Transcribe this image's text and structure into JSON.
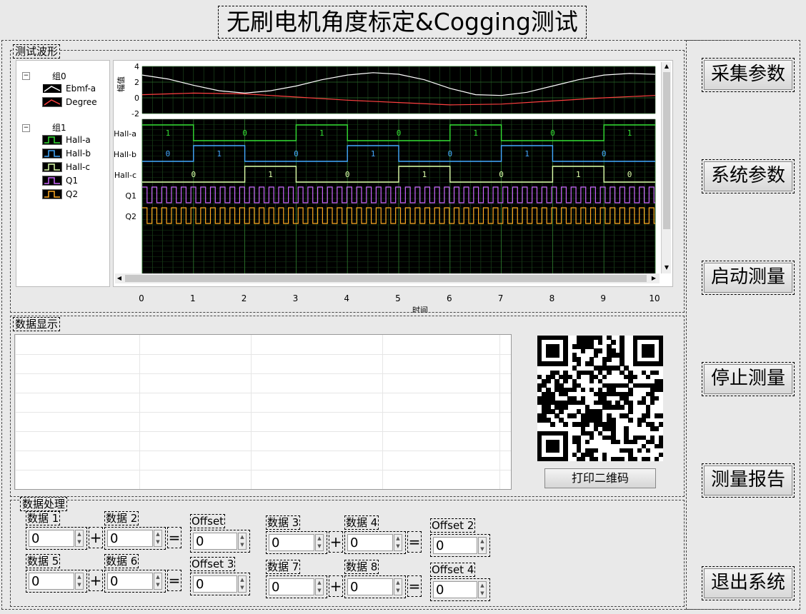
{
  "title": "无刷电机角度标定&Cogging测试",
  "waveform_section": {
    "label": "测试波形",
    "groups": [
      {
        "name": "组0",
        "items": [
          {
            "name": "Ebmf-a",
            "color": "#ffffff"
          },
          {
            "name": "Degree",
            "color": "#ff4040"
          }
        ]
      },
      {
        "name": "组1",
        "items": [
          {
            "name": "Hall-a",
            "color": "#33dd33"
          },
          {
            "name": "Hall-b",
            "color": "#44aaff"
          },
          {
            "name": "Hall-c",
            "color": "#ddffaa"
          },
          {
            "name": "Q1",
            "color": "#cc66ff"
          },
          {
            "name": "Q2",
            "color": "#ffaa22"
          }
        ]
      }
    ],
    "top_axis_label": "幅值",
    "x_axis_label": "时间"
  },
  "chart_data": {
    "type": "line",
    "title": "",
    "xlabel": "时间",
    "ylabel": "幅值",
    "x_ticks": [
      0,
      1,
      2,
      3,
      4,
      5,
      6,
      7,
      8,
      9,
      10
    ],
    "xlim": [
      0,
      10
    ],
    "analog_ylim": [
      -2,
      4
    ],
    "analog_yticks": [
      4,
      2,
      0,
      -2
    ],
    "analog_series": [
      {
        "name": "Ebmf-a",
        "color": "#ffffff",
        "x": [
          0,
          0.5,
          1,
          1.5,
          2,
          2.5,
          3,
          3.5,
          4,
          4.5,
          5,
          5.5,
          6,
          6.5,
          7,
          7.5,
          8,
          8.5,
          9,
          9.5,
          10
        ],
        "y": [
          2.9,
          2.4,
          1.6,
          0.9,
          0.6,
          0.9,
          1.5,
          2.3,
          2.9,
          3.2,
          3.0,
          2.3,
          1.2,
          0.4,
          0.3,
          0.7,
          1.5,
          2.3,
          2.9,
          3.1,
          3.0
        ]
      },
      {
        "name": "Degree",
        "color": "#ff4040",
        "x": [
          0,
          1,
          2,
          3,
          4,
          5,
          6,
          7,
          8,
          9,
          10
        ],
        "y": [
          0.4,
          0.6,
          0.5,
          0.1,
          -0.3,
          -0.6,
          -0.9,
          -0.8,
          -0.4,
          0.0,
          0.3
        ]
      }
    ],
    "digital_series": [
      {
        "name": "Hall-a",
        "color": "#33dd33",
        "transitions": [
          0,
          1,
          3,
          4,
          6,
          7,
          9,
          10
        ],
        "levels": [
          1,
          0,
          1,
          0,
          1,
          0,
          1
        ],
        "labels": [
          "1",
          "0",
          "1",
          "0",
          "1",
          "0",
          "1"
        ]
      },
      {
        "name": "Hall-b",
        "color": "#44aaff",
        "transitions": [
          0,
          1,
          2,
          4,
          5,
          7,
          8,
          10
        ],
        "levels": [
          0,
          1,
          0,
          1,
          0,
          1,
          0
        ],
        "labels": [
          "0",
          "1",
          "0",
          "1",
          "0",
          "1",
          "0"
        ]
      },
      {
        "name": "Hall-c",
        "color": "#ddffaa",
        "transitions": [
          0,
          2,
          3,
          5,
          6,
          8,
          9,
          10
        ],
        "levels": [
          0,
          1,
          0,
          1,
          0,
          1,
          0
        ],
        "labels": [
          "0",
          "1",
          "0",
          "1",
          "0",
          "1",
          "0"
        ]
      },
      {
        "name": "Q1",
        "color": "#cc66ff",
        "period": 0.19,
        "labels": []
      },
      {
        "name": "Q2",
        "color": "#ffaa22",
        "period": 0.19,
        "labels": []
      }
    ],
    "grid": true,
    "background": "#000000"
  },
  "data_display": {
    "label": "数据显示",
    "print_qr_button": "打印二维码"
  },
  "data_processing": {
    "label": "数据处理",
    "rows": [
      {
        "a_label": "数据 1",
        "a_val": "0",
        "b_label": "数据 2",
        "b_val": "0",
        "offset_label": "Offset",
        "offset_val": "0"
      },
      {
        "a_label": "数据 5",
        "a_val": "0",
        "b_label": "数据 6",
        "b_val": "0",
        "offset_label": "Offset 3",
        "offset_val": "0"
      },
      {
        "a_label": "数据 3",
        "a_val": "0",
        "b_label": "数据 4",
        "b_val": "0",
        "offset_label": "Offset 2",
        "offset_val": "0"
      },
      {
        "a_label": "数据 7",
        "a_val": "0",
        "b_label": "数据 8",
        "b_val": "0",
        "offset_label": "Offset 4",
        "offset_val": "0"
      }
    ],
    "plus": "+",
    "equals": "="
  },
  "sidebar": {
    "buttons": [
      "采集参数",
      "系统参数",
      "启动测量",
      "停止测量",
      "测量报告",
      "退出系统"
    ]
  }
}
